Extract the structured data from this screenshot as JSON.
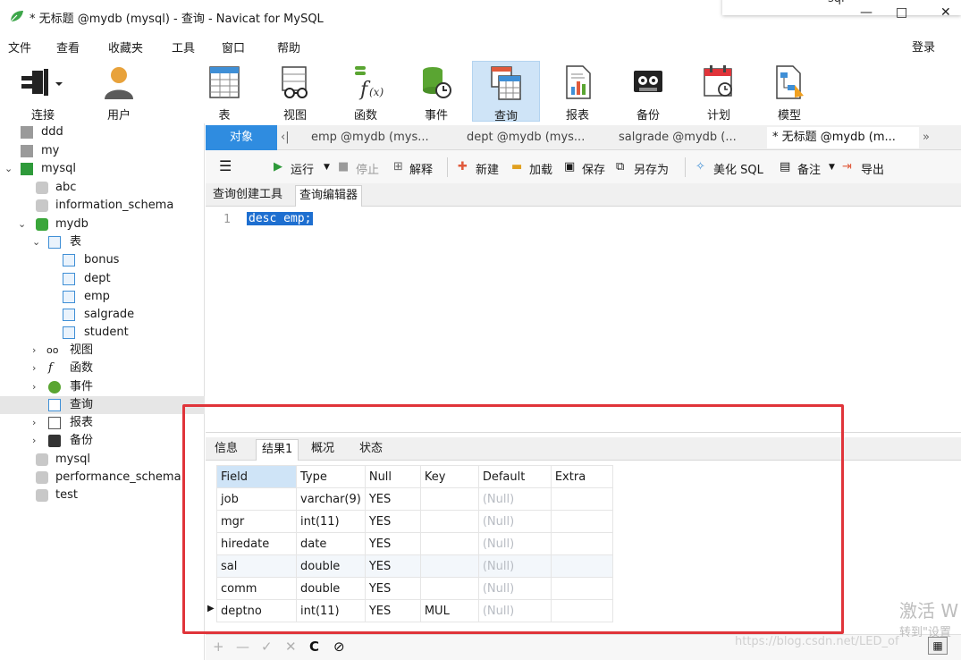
{
  "window": {
    "title": "* 无标题 @mydb (mysql) - 查询 - Navicat for MySQL",
    "ghost_text": "sql",
    "controls": [
      "—",
      "□",
      "✕"
    ]
  },
  "menu": [
    "文件",
    "查看",
    "收藏夹",
    "工具",
    "窗口",
    "帮助"
  ],
  "login_label": "登录",
  "toolbar": [
    {
      "label": "连接",
      "icon": "plug-icon"
    },
    {
      "label": "用户",
      "icon": "user-icon"
    },
    {
      "label": "表",
      "icon": "table-icon"
    },
    {
      "label": "视图",
      "icon": "view-icon"
    },
    {
      "label": "函数",
      "icon": "function-icon"
    },
    {
      "label": "事件",
      "icon": "event-icon"
    },
    {
      "label": "查询",
      "icon": "query-icon",
      "active": true
    },
    {
      "label": "报表",
      "icon": "report-icon"
    },
    {
      "label": "备份",
      "icon": "backup-icon"
    },
    {
      "label": "计划",
      "icon": "calendar-icon"
    },
    {
      "label": "模型",
      "icon": "model-icon"
    }
  ],
  "sidebar": {
    "items": [
      {
        "label": "ddd"
      },
      {
        "label": "my"
      },
      {
        "label": "mysql"
      },
      {
        "label": "abc"
      },
      {
        "label": "information_schema"
      },
      {
        "label": "mydb"
      },
      {
        "label": "表"
      },
      {
        "label": "bonus"
      },
      {
        "label": "dept"
      },
      {
        "label": "emp"
      },
      {
        "label": "salgrade"
      },
      {
        "label": "student"
      },
      {
        "label": "视图"
      },
      {
        "label": "函数"
      },
      {
        "label": "事件"
      },
      {
        "label": "查询"
      },
      {
        "label": "报表"
      },
      {
        "label": "备份"
      },
      {
        "label": "mysql"
      },
      {
        "label": "performance_schema"
      },
      {
        "label": "test"
      }
    ]
  },
  "tabs": {
    "objects": "对象",
    "docs": [
      "emp @mydb (mys...",
      "dept @mydb (mys...",
      "salgrade @mydb (...",
      "* 无标题 @mydb (m..."
    ]
  },
  "query_toolbar": {
    "run": "运行",
    "stop": "停止",
    "explain": "解释",
    "new": "新建",
    "load": "加载",
    "save": "保存",
    "save_as": "另存为",
    "beautify": "美化 SQL",
    "note": "备注",
    "export": "导出"
  },
  "subtabs": [
    "查询创建工具",
    "查询编辑器"
  ],
  "editor": {
    "line": "1",
    "code": "desc emp;"
  },
  "result_tabs": [
    "信息",
    "结果1",
    "概况",
    "状态"
  ],
  "result_grid": {
    "columns": [
      "Field",
      "Type",
      "Null",
      "Key",
      "Default",
      "Extra"
    ],
    "rows": [
      [
        "job",
        "varchar(9)",
        "YES",
        "",
        "(Null)",
        ""
      ],
      [
        "mgr",
        "int(11)",
        "YES",
        "",
        "(Null)",
        ""
      ],
      [
        "hiredate",
        "date",
        "YES",
        "",
        "(Null)",
        ""
      ],
      [
        "sal",
        "double",
        "YES",
        "",
        "(Null)",
        ""
      ],
      [
        "comm",
        "double",
        "YES",
        "",
        "(Null)",
        ""
      ],
      [
        "deptno",
        "int(11)",
        "YES",
        "MUL",
        "(Null)",
        ""
      ]
    ]
  },
  "bottom_bar": [
    "+",
    "—",
    "✓",
    "✕",
    "C",
    "⊘"
  ],
  "watermark": {
    "line1": "激活 W",
    "line2": "转到\"设置",
    "url": "https://blog.csdn.net/LED_of"
  },
  "colors": {
    "accent": "#2f8ce0",
    "highlight": "#e0343a",
    "selection": "#1e6fd0"
  }
}
